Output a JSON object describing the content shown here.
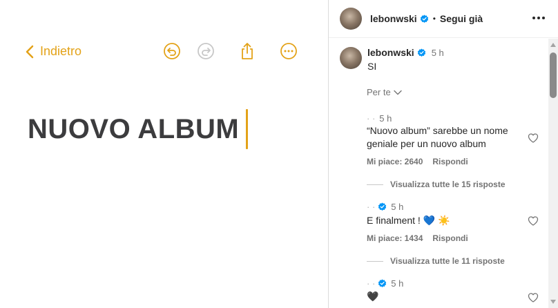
{
  "notes": {
    "back_label": "Indietro",
    "note_title": "NUOVO ALBUM",
    "accent_color": "#e3a218",
    "tools": [
      "back-chevron-icon",
      "undo-icon",
      "redo-icon",
      "share-icon",
      "more-circle-icon"
    ]
  },
  "instagram": {
    "header": {
      "username": "lebonwski",
      "separator": "•",
      "follow_label": "Segui già",
      "more_icon": "more-horizontal-icon"
    },
    "post": {
      "username": "lebonwski",
      "time": "5 h",
      "caption": "SI"
    },
    "sort_label": "Per te",
    "comments": [
      {
        "username": "· ·",
        "time": "5 h",
        "text": "“Nuovo album” sarebbe un nome geniale per un nuovo album",
        "likes_label": "Mi piace: 2640",
        "reply_label": "Rispondi",
        "replies_label": "Visualizza tutte le 15 risposte"
      },
      {
        "username": "· ·",
        "time": "5 h",
        "text": "E finalment ! 💙 ☀️",
        "likes_label": "Mi piace: 1434",
        "reply_label": "Rispondi",
        "replies_label": "Visualizza tutte le 11 risposte"
      },
      {
        "username": "· ·",
        "time": "5 h",
        "text": "🖤"
      }
    ],
    "verified_color": "#0095f6"
  }
}
